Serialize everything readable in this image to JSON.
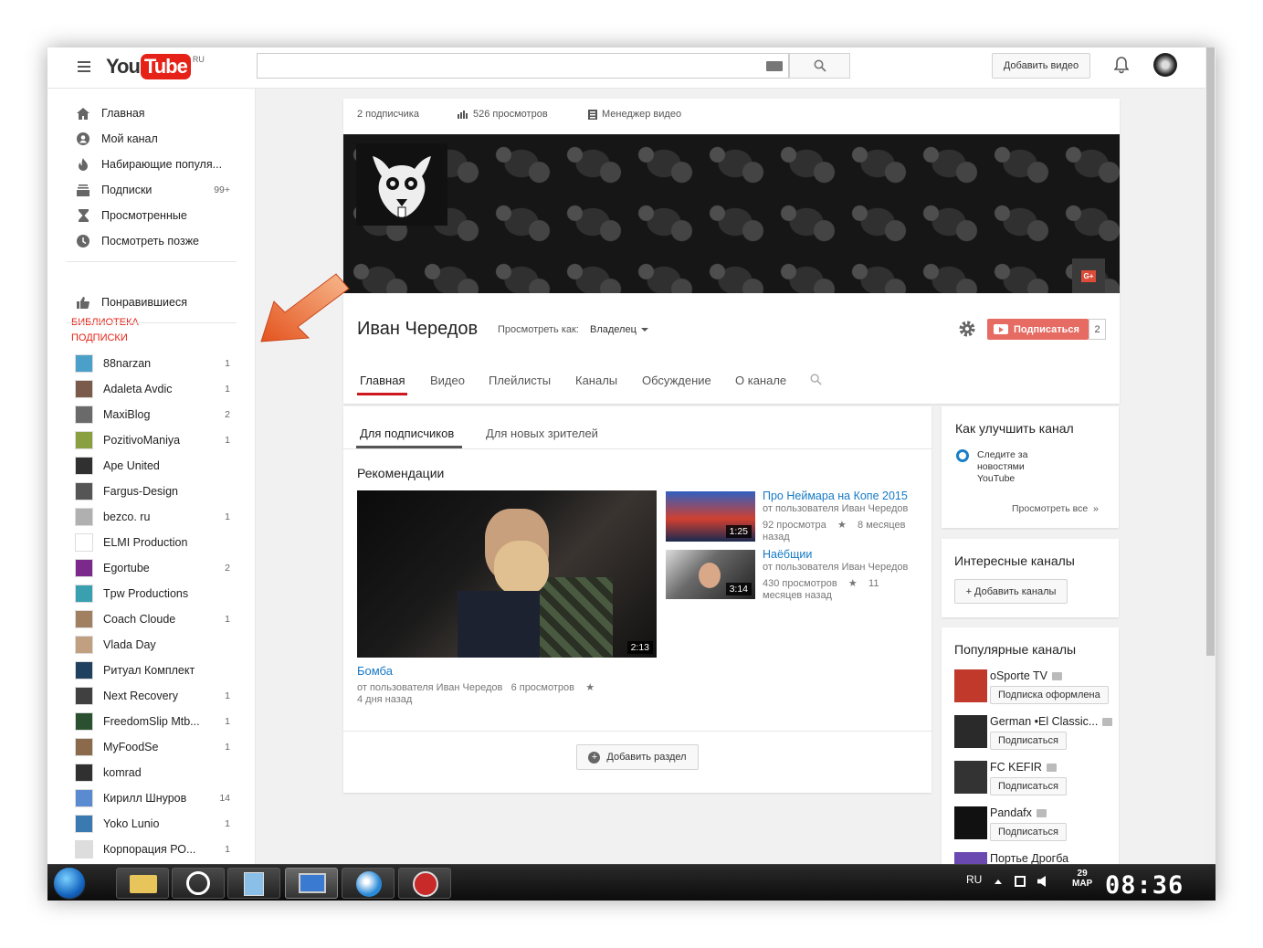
{
  "masthead": {
    "logo_you": "You",
    "logo_tube": "Tube",
    "logo_region": "RU",
    "upload_label": "Добавить видео"
  },
  "guide": {
    "items": [
      {
        "label": "Главная",
        "icon": "home-icon"
      },
      {
        "label": "Мой канал",
        "icon": "user-icon"
      },
      {
        "label": "Набирающие популя...",
        "icon": "fire-icon"
      },
      {
        "label": "Подписки",
        "icon": "subscriptions-icon",
        "count": "99+"
      },
      {
        "label": "Просмотренные",
        "icon": "hourglass-icon"
      },
      {
        "label": "Посмотреть позже",
        "icon": "clock-icon"
      }
    ],
    "library_header": "БИБЛИОТЕКА",
    "library": [
      {
        "label": "Понравившиеся",
        "icon": "thumbs-up-icon"
      }
    ],
    "subs_header": "ПОДПИСКИ",
    "subscriptions": [
      {
        "label": "88narzan",
        "count": "1",
        "color": "#4aa0c8"
      },
      {
        "label": "Adaleta Avdic",
        "count": "1",
        "color": "#7a5a4a"
      },
      {
        "label": "MaxiBlog",
        "count": "2",
        "color": "#6a6a6a"
      },
      {
        "label": "PozitivoManiya",
        "count": "1",
        "color": "#8aa040"
      },
      {
        "label": "Ape United",
        "count": "",
        "color": "#303030"
      },
      {
        "label": "Fargus-Design",
        "count": "",
        "color": "#555555"
      },
      {
        "label": "bezco. ru",
        "count": "1",
        "color": "#b0b0b0"
      },
      {
        "label": "ELMI Production",
        "count": "",
        "color": "#ffffff"
      },
      {
        "label": "Egortube",
        "count": "2",
        "color": "#7b2a8c"
      },
      {
        "label": "Tpw Productions",
        "count": "",
        "color": "#3aa0b0"
      },
      {
        "label": "Coach Cloude",
        "count": "1",
        "color": "#a08060"
      },
      {
        "label": "Vlada Day",
        "count": "",
        "color": "#c0a080"
      },
      {
        "label": "Ритуал Комплект",
        "count": "",
        "color": "#204060"
      },
      {
        "label": "Next Recovery",
        "count": "1",
        "color": "#404040"
      },
      {
        "label": "FreedomSlip Mtb...",
        "count": "1",
        "color": "#2a5030"
      },
      {
        "label": "MyFoodSe",
        "count": "1",
        "color": "#8a6a4a"
      },
      {
        "label": "komrad",
        "count": "",
        "color": "#303030"
      },
      {
        "label": "Кирилл Шнуров",
        "count": "14",
        "color": "#5a8ad0"
      },
      {
        "label": "Yoko Lunio",
        "count": "1",
        "color": "#3a7ab0"
      },
      {
        "label": "Корпорация РО...",
        "count": "1",
        "color": "#dddddd"
      }
    ]
  },
  "channel": {
    "stats": {
      "subscribers": "2 подписчика",
      "views": "526 просмотров",
      "manager": "Менеджер видео"
    },
    "name": "Иван Чередов",
    "view_as_label": "Просмотреть как:",
    "view_as_value": "Владелец",
    "subscribe_label": "Подписаться",
    "subscribe_count": "2",
    "tabs": [
      "Главная",
      "Видео",
      "Плейлисты",
      "Каналы",
      "Обсуждение",
      "О канале"
    ]
  },
  "content": {
    "subtabs": [
      "Для подписчиков",
      "Для новых зрителей"
    ],
    "section_title": "Рекомендации",
    "main_video": {
      "title": "Бомба",
      "by": "от пользователя Иван Чередов",
      "views": "6 просмотров",
      "star": "★",
      "age": "4 дня назад",
      "duration": "2:13"
    },
    "side_videos": [
      {
        "title": "Про Неймара на Копе 2015",
        "by": "от пользователя Иван Чередов",
        "views": "92 просмотра",
        "star": "★",
        "age_a": "8 месяцев",
        "age_b": "назад",
        "duration": "1:25"
      },
      {
        "title": "Наёбщии",
        "by": "от пользователя Иван Чередов",
        "views": "430 просмотров",
        "star": "★",
        "age_a": "11",
        "age_b": "месяцев назад",
        "duration": "3:14"
      }
    ],
    "add_section_label": "Добавить раздел"
  },
  "right": {
    "improve_title": "Как улучшить канал",
    "improve_item": [
      "Следите за",
      "новостями",
      "YouTube"
    ],
    "view_all": "Просмотреть все",
    "view_all_arrow": "»",
    "interesting_title": "Интересные каналы",
    "add_channels": "+ Добавить каналы",
    "popular_title": "Популярные каналы",
    "popular": [
      {
        "name": "oSporte TV",
        "button": "Подписка оформлена",
        "color": "#c0392b"
      },
      {
        "name": "German •El Classic...",
        "button": "Подписаться",
        "color": "#2a2a2a"
      },
      {
        "name": "FC KEFIR",
        "button": "Подписаться",
        "color": "#333333"
      },
      {
        "name": "Pandafx",
        "button": "Подписаться",
        "color": "#111111"
      },
      {
        "name": "Портье Дрогба",
        "button": "",
        "color": "#6a4ab0"
      }
    ]
  },
  "taskbar": {
    "lang": "RU",
    "date_day": "29",
    "date_month": "МАР",
    "time": "08:36"
  }
}
